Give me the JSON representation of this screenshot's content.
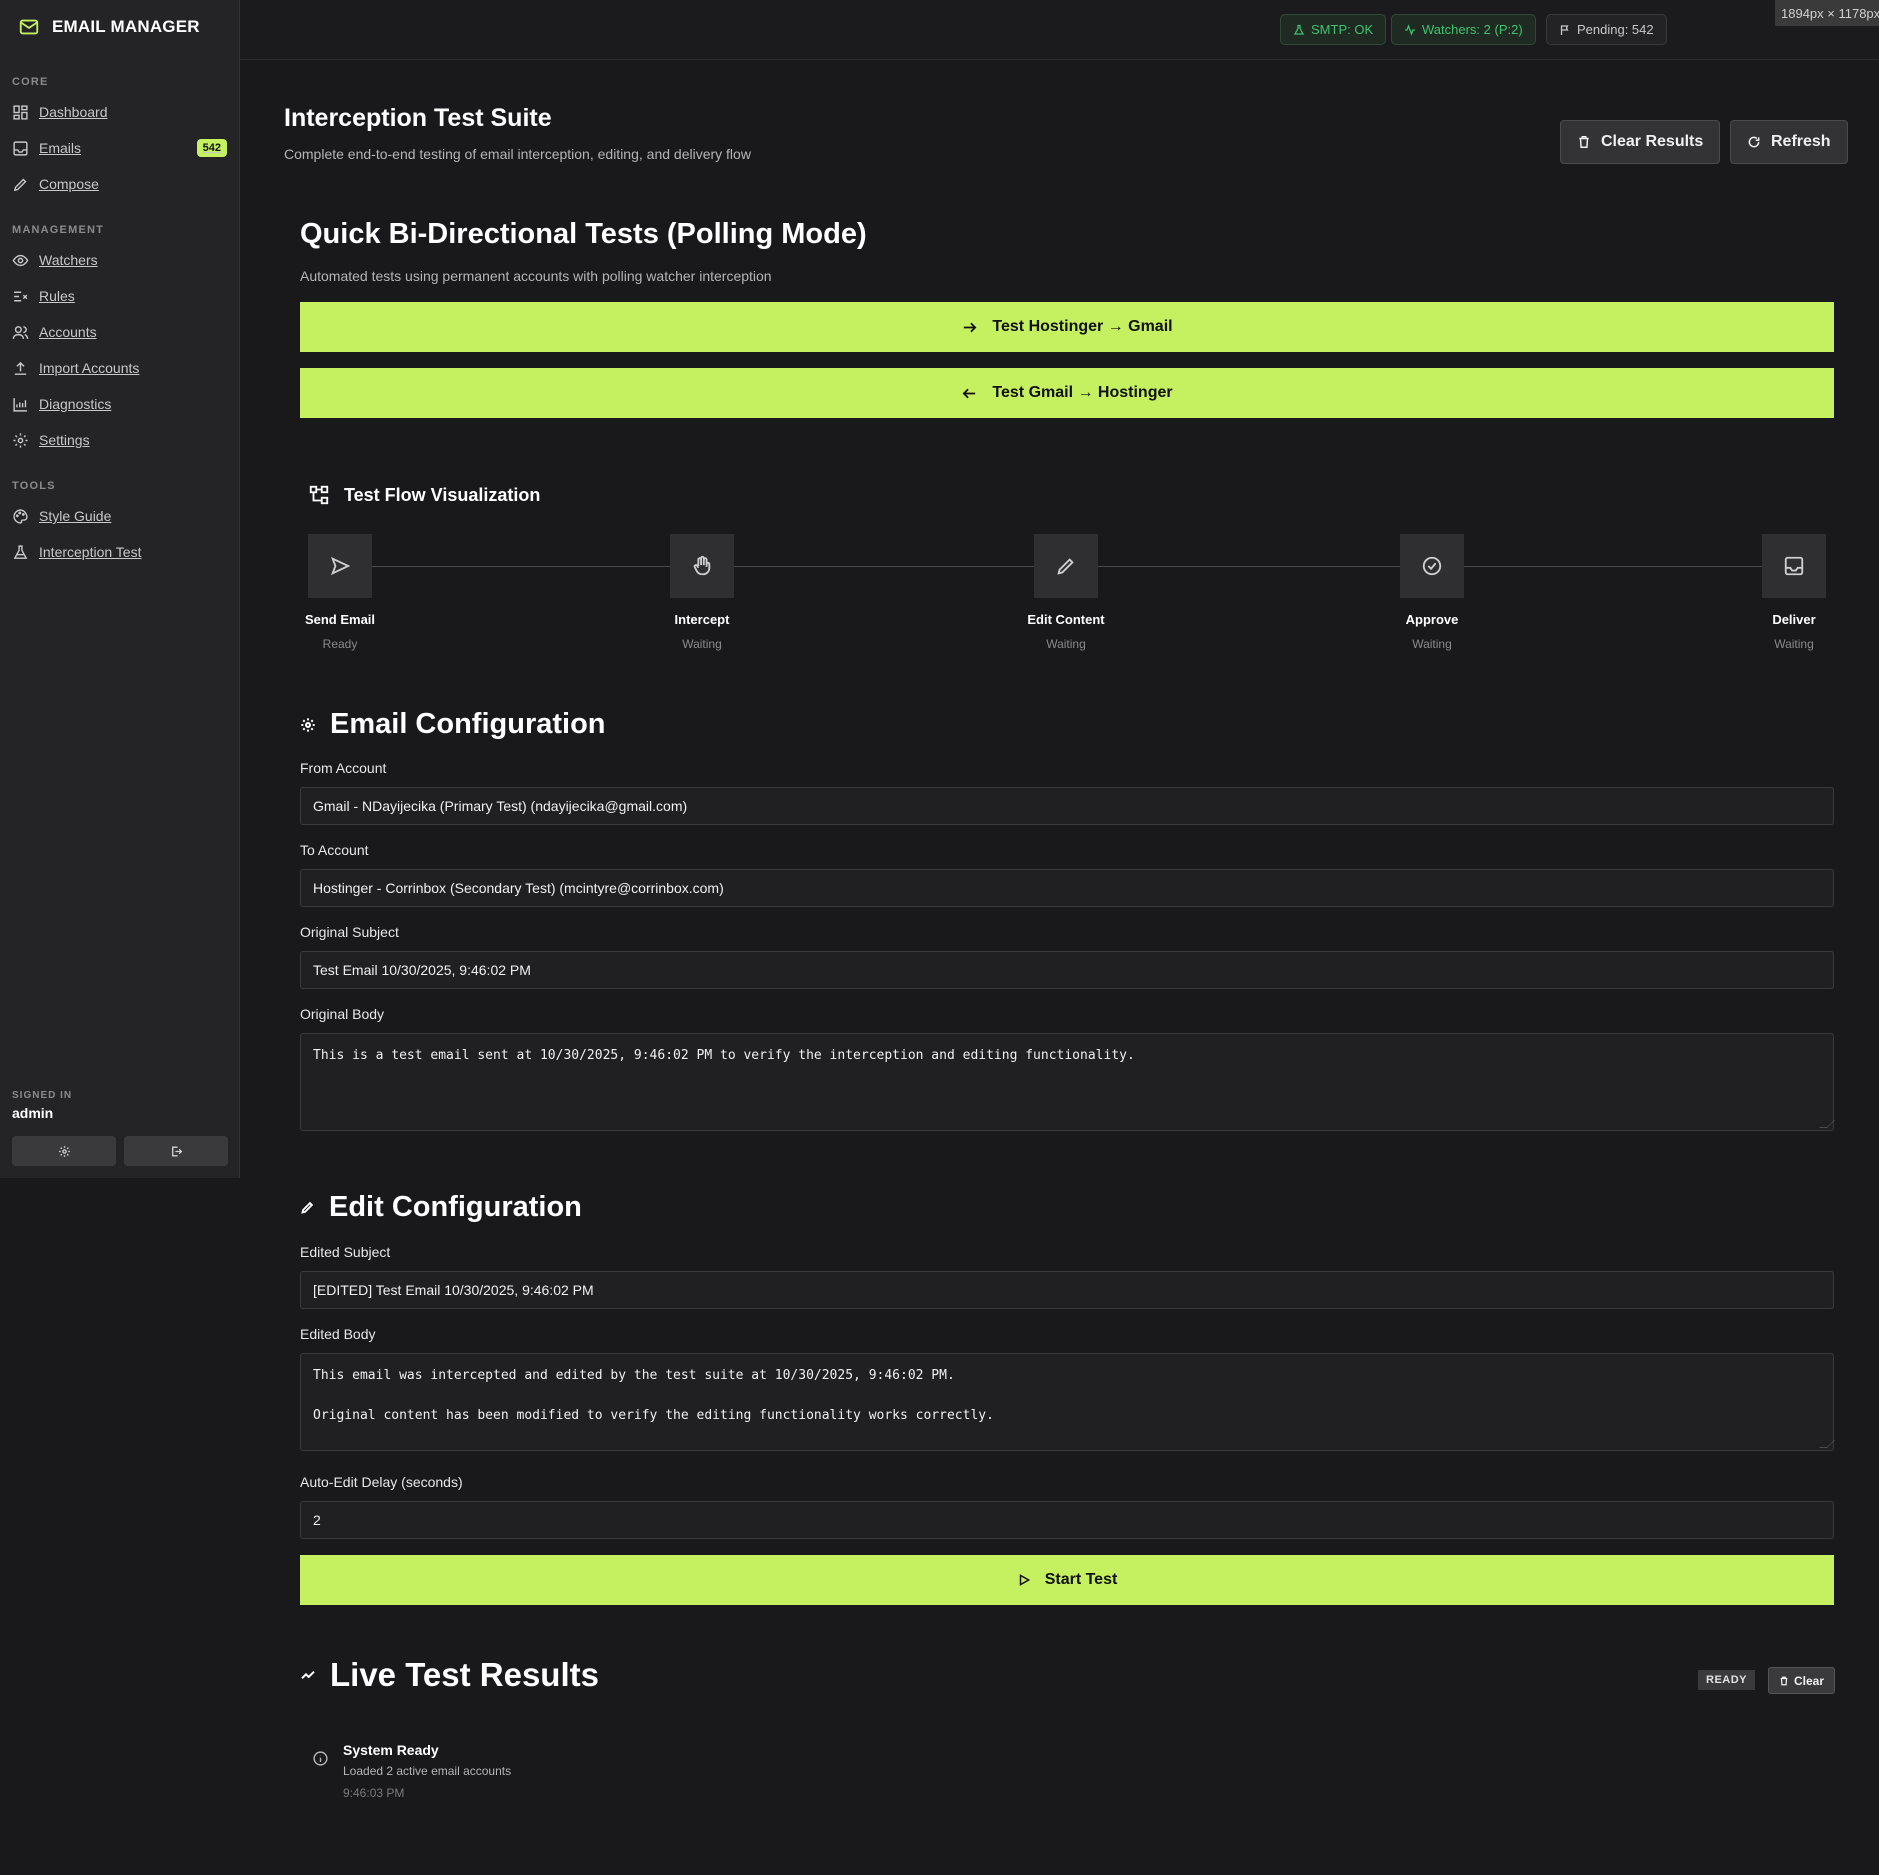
{
  "brand": {
    "name": "EMAIL MANAGER",
    "icon": "mail-icon"
  },
  "sidebar": {
    "sections": [
      {
        "title": "CORE"
      },
      {
        "title": "MANAGEMENT"
      },
      {
        "title": "TOOLS"
      }
    ],
    "items": [
      {
        "label": "Dashboard",
        "icon": "dashboard-icon"
      },
      {
        "label": "Emails",
        "icon": "inbox-icon",
        "badge": "542"
      },
      {
        "label": "Compose",
        "icon": "pencil-icon"
      },
      {
        "label": "Watchers",
        "icon": "eye-icon"
      },
      {
        "label": "Rules",
        "icon": "rules-icon"
      },
      {
        "label": "Accounts",
        "icon": "users-icon"
      },
      {
        "label": "Import Accounts",
        "icon": "upload-icon"
      },
      {
        "label": "Diagnostics",
        "icon": "chart-icon"
      },
      {
        "label": "Settings",
        "icon": "gear-icon"
      },
      {
        "label": "Style Guide",
        "icon": "palette-icon"
      },
      {
        "label": "Interception Test",
        "icon": "flask-icon"
      }
    ],
    "signed_in_caption": "SIGNED IN",
    "user": "admin"
  },
  "topbar": {
    "smtp": "SMTP: OK",
    "watchers": "Watchers: 2 (P:2)",
    "pending": "Pending: 542",
    "dims_tag": "1894px × 1178px"
  },
  "header": {
    "title": "Interception Test Suite",
    "subtitle": "Complete end-to-end testing of email interception, editing, and delivery flow",
    "clear_results": "Clear Results",
    "refresh": "Refresh"
  },
  "quick": {
    "title": "Quick Bi-Directional Tests (Polling Mode)",
    "subtitle": "Automated tests using permanent accounts with polling watcher interception",
    "btn_h2g": "Test Hostinger → Gmail",
    "btn_g2h": "Test Gmail → Hostinger"
  },
  "flow": {
    "title": "Test Flow Visualization",
    "steps": [
      {
        "name": "Send Email",
        "status": "Ready",
        "icon": "send-icon"
      },
      {
        "name": "Intercept",
        "status": "Waiting",
        "icon": "hand-icon"
      },
      {
        "name": "Edit Content",
        "status": "Waiting",
        "icon": "pencil-icon"
      },
      {
        "name": "Approve",
        "status": "Waiting",
        "icon": "check-circle-icon"
      },
      {
        "name": "Deliver",
        "status": "Waiting",
        "icon": "inbox-icon"
      }
    ]
  },
  "email_config": {
    "title": "Email Configuration",
    "from_label": "From Account",
    "from_value": "Gmail - NDayijecika (Primary Test) (ndayijecika@gmail.com)",
    "to_label": "To Account",
    "to_value": "Hostinger - Corrinbox (Secondary Test) (mcintyre@corrinbox.com)",
    "subject_label": "Original Subject",
    "subject_value": "Test Email 10/30/2025, 9:46:02 PM",
    "body_label": "Original Body",
    "body_value": "This is a test email sent at 10/30/2025, 9:46:02 PM to verify the interception and editing functionality."
  },
  "edit_config": {
    "title": "Edit Configuration",
    "subject_label": "Edited Subject",
    "subject_value": "[EDITED] Test Email 10/30/2025, 9:46:02 PM",
    "body_label": "Edited Body",
    "body_value": "This email was intercepted and edited by the test suite at 10/30/2025, 9:46:02 PM.\n\nOriginal content has been modified to verify the editing functionality works correctly.",
    "delay_label": "Auto-Edit Delay (seconds)",
    "delay_value": "2",
    "start_button": "Start Test"
  },
  "results": {
    "title": "Live Test Results",
    "status": "READY",
    "clear": "Clear",
    "items": [
      {
        "title": "System Ready",
        "desc": "Loaded 2 active email accounts",
        "time": "9:46:03 PM"
      }
    ]
  },
  "colors": {
    "accent": "#c5f060",
    "ok": "#3ec46d",
    "bg": "#19191b",
    "sidebar": "#242426"
  }
}
